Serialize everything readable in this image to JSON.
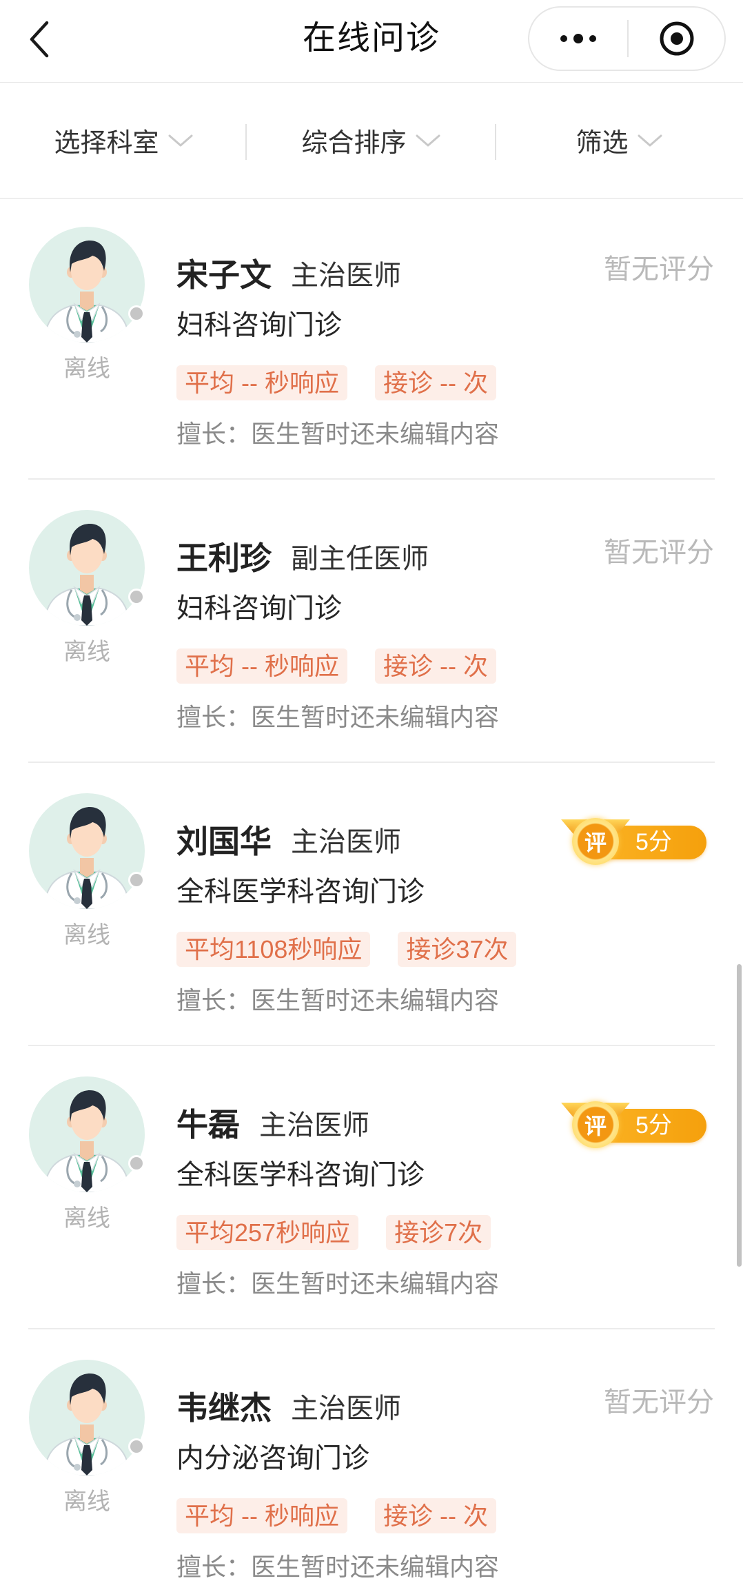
{
  "header": {
    "title": "在线问诊",
    "back_icon": "chevron-left-icon",
    "more_icon": "more-dots-icon",
    "close_icon": "target-circle-icon"
  },
  "filters": [
    {
      "label": "选择科室",
      "icon": "chevron-down-icon"
    },
    {
      "label": "综合排序",
      "icon": "chevron-down-icon"
    },
    {
      "label": "筛选",
      "icon": "chevron-down-icon"
    }
  ],
  "doctors": [
    {
      "name": "宋子文",
      "title": "主治医师",
      "department": "妇科咨询门诊",
      "status": "离线",
      "response_tag": "平均 -- 秒响应",
      "consult_tag": "接诊 -- 次",
      "expertise_label": "擅长：",
      "expertise": "医生暂时还未编辑内容",
      "rating": {
        "text": "暂无评分"
      }
    },
    {
      "name": "王利珍",
      "title": "副主任医师",
      "department": "妇科咨询门诊",
      "status": "离线",
      "response_tag": "平均 -- 秒响应",
      "consult_tag": "接诊 -- 次",
      "expertise_label": "擅长：",
      "expertise": "医生暂时还未编辑内容",
      "rating": {
        "text": "暂无评分"
      }
    },
    {
      "name": "刘国华",
      "title": "主治医师",
      "department": "全科医学科咨询门诊",
      "status": "离线",
      "response_tag": "平均1108秒响应",
      "consult_tag": "接诊37次",
      "expertise_label": "擅长：",
      "expertise": "医生暂时还未编辑内容",
      "rating": {
        "badge_label": "评",
        "score": "5分"
      }
    },
    {
      "name": "牛磊",
      "title": "主治医师",
      "department": "全科医学科咨询门诊",
      "status": "离线",
      "response_tag": "平均257秒响应",
      "consult_tag": "接诊7次",
      "expertise_label": "擅长：",
      "expertise": "医生暂时还未编辑内容",
      "rating": {
        "badge_label": "评",
        "score": "5分"
      }
    },
    {
      "name": "韦继杰",
      "title": "主治医师",
      "department": "内分泌咨询门诊",
      "status": "离线",
      "response_tag": "平均 -- 秒响应",
      "consult_tag": "接诊 -- 次",
      "expertise_label": "擅长：",
      "expertise": "医生暂时还未编辑内容",
      "rating": {
        "text": "暂无评分"
      }
    }
  ],
  "icons": {
    "avatar": "doctor-avatar-icon",
    "status": "offline-dot-icon",
    "rating_badge": "rating-medal-icon"
  },
  "colors": {
    "tag_text": "#e0704a",
    "tag_background": "#fdeee8",
    "avatar_background": "#dff0ea",
    "offline_dot": "#c6c6c6",
    "rating_badge": "#f5a00c"
  }
}
